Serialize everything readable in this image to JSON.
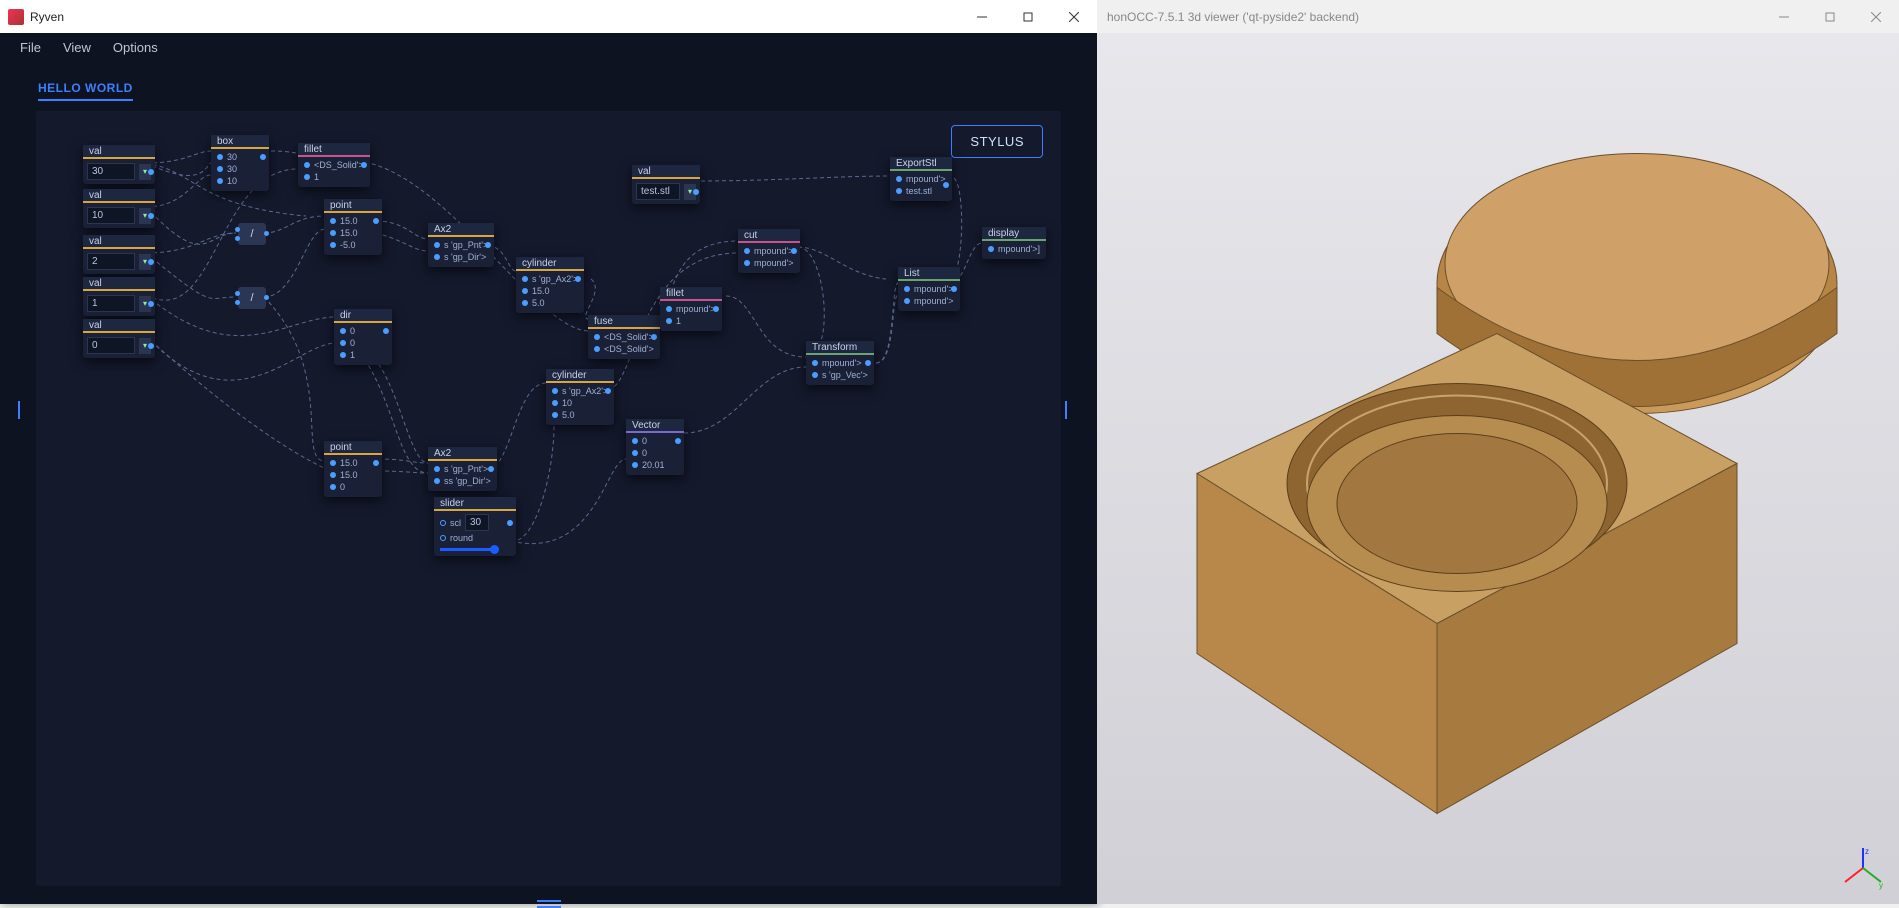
{
  "ryven": {
    "title": "Ryven",
    "menu": {
      "file": "File",
      "view": "View",
      "options": "Options"
    },
    "tab": "HELLO WORLD",
    "stylus_btn": "STYLUS"
  },
  "occ": {
    "title": "honOCC-7.5.1 3d viewer ('qt-pyside2' backend)"
  },
  "ops": {
    "div1": "/",
    "div2": "/"
  },
  "nodes": {
    "val0": {
      "title": "val",
      "value": "30"
    },
    "val1": {
      "title": "val",
      "value": "10"
    },
    "val2": {
      "title": "val",
      "value": "2"
    },
    "val3": {
      "title": "val",
      "value": "1"
    },
    "val4": {
      "title": "val",
      "value": "0"
    },
    "valstr": {
      "title": "val",
      "value": "test.stl"
    },
    "box": {
      "title": "box",
      "r": [
        "30",
        "30",
        "10"
      ]
    },
    "fillet1": {
      "title": "fillet",
      "r": [
        "<DS_Solid'>",
        "1"
      ]
    },
    "point1": {
      "title": "point",
      "r": [
        "15.0",
        "15.0",
        "-5.0"
      ]
    },
    "point2": {
      "title": "point",
      "r": [
        "15.0",
        "15.0",
        "0"
      ]
    },
    "ax2a": {
      "title": "Ax2",
      "r": [
        "s 'gp_Pnt'>",
        "s 'gp_Dir'>"
      ]
    },
    "ax2b": {
      "title": "Ax2",
      "r": [
        "s 'gp_Pnt'>",
        "ss 'gp_Dir'>"
      ]
    },
    "cyl1": {
      "title": "cylinder",
      "r": [
        "s 'gp_Ax2'>",
        "15.0",
        "5.0"
      ]
    },
    "cyl2": {
      "title": "cylinder",
      "r": [
        "s 'gp_Ax2'>",
        "10",
        "5.0"
      ]
    },
    "dir": {
      "title": "dir",
      "r": [
        "0",
        "0",
        "1"
      ]
    },
    "fuse": {
      "title": "fuse",
      "r": [
        "<DS_Solid'>",
        "<DS_Solid'>"
      ]
    },
    "cut": {
      "title": "cut",
      "r": [
        "mpound'>",
        "mpound'>"
      ]
    },
    "fillet2": {
      "title": "fillet",
      "r": [
        "mpound'>",
        "1"
      ]
    },
    "vector": {
      "title": "Vector",
      "r": [
        "0",
        "0",
        "20.01"
      ]
    },
    "transform": {
      "title": "Transform",
      "r": [
        "mpound'>",
        "s 'gp_Vec'>"
      ]
    },
    "list": {
      "title": "List",
      "r": [
        "mpound'>",
        "mpound'>"
      ]
    },
    "export": {
      "title": "ExportStl",
      "r": [
        "mpound'>",
        "test.stl"
      ]
    },
    "display": {
      "title": "display",
      "r": [
        "mpound'>]"
      ]
    },
    "slider": {
      "title": "slider",
      "scl": "scl",
      "val": "30",
      "round": "round"
    }
  }
}
